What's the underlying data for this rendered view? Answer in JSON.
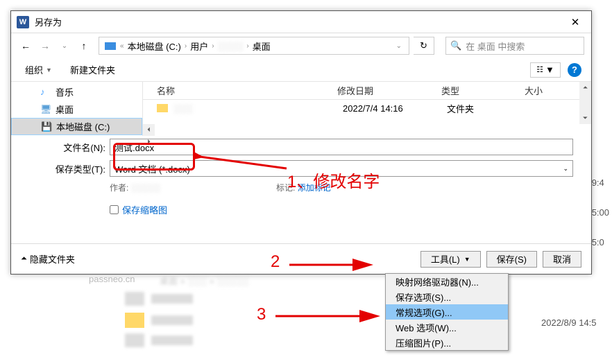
{
  "dialog": {
    "title": "另存为",
    "path": {
      "root": "本地磁盘 (C:)",
      "p1": "用户",
      "p2": "桌面"
    },
    "search_placeholder": "在 桌面 中搜索",
    "toolbar": {
      "organize": "组织",
      "newfolder": "新建文件夹"
    },
    "sidebar": {
      "music": "音乐",
      "desktop": "桌面",
      "disk": "本地磁盘 (C:)"
    },
    "columns": {
      "name": "名称",
      "date": "修改日期",
      "type": "类型",
      "size": "大小"
    },
    "rows": [
      {
        "date": "2022/7/4 14:16",
        "type": "文件夹"
      }
    ],
    "form": {
      "filename_label": "文件名(N):",
      "filename_value": "测试.docx",
      "filetype_label": "保存类型(T):",
      "filetype_value": "Word 文档 (*.docx)",
      "author_label": "作者:",
      "tags_label": "标记:",
      "tags_link": "添加标记",
      "thumbnail": "保存缩略图"
    },
    "footer": {
      "hide": "隐藏文件夹",
      "tools": "工具(L)",
      "save": "保存(S)",
      "cancel": "取消"
    }
  },
  "dropdown": {
    "items": [
      "映射网络驱动器(N)...",
      "保存选项(S)...",
      "常规选项(G)...",
      "Web 选项(W)...",
      "压缩图片(P)..."
    ],
    "highlighted": 2
  },
  "annotations": {
    "a1": "1、修改名字",
    "a2": "2",
    "a3": "3"
  },
  "background": {
    "watermark": "passneo.cn",
    "date": "2022/8/9 14:5",
    "times": [
      "9:4",
      "5:00",
      "5:0"
    ]
  }
}
